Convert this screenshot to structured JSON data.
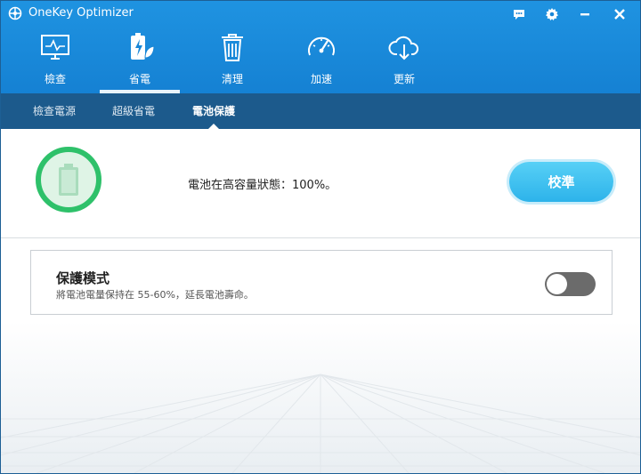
{
  "window": {
    "title": "OneKey Optimizer",
    "title_icons": [
      "feedback-icon",
      "settings-icon",
      "minimize-icon",
      "close-icon"
    ]
  },
  "nav": {
    "items": [
      {
        "label": "檢查",
        "icon": "monitor-icon"
      },
      {
        "label": "省電",
        "icon": "battery-leaf-icon",
        "active": true
      },
      {
        "label": "清理",
        "icon": "trash-icon"
      },
      {
        "label": "加速",
        "icon": "speedometer-icon"
      },
      {
        "label": "更新",
        "icon": "cloud-download-icon"
      }
    ]
  },
  "subnav": {
    "tabs": [
      {
        "label": "檢查電源"
      },
      {
        "label": "超級省電"
      },
      {
        "label": "電池保護",
        "active": true
      }
    ]
  },
  "status": {
    "message": "電池在高容量狀態：100%。",
    "calibrate_label": "校準"
  },
  "protection": {
    "title": "保護模式",
    "description": "將電池電量保持在 55-60%，延長電池壽命。",
    "enabled": false
  },
  "colors": {
    "header": "#1f93e1",
    "subnav": "#1c5a8c",
    "accent_green": "#2ec16a",
    "button_blue": "#2db3ea",
    "toggle_off": "#6b6b6b"
  }
}
